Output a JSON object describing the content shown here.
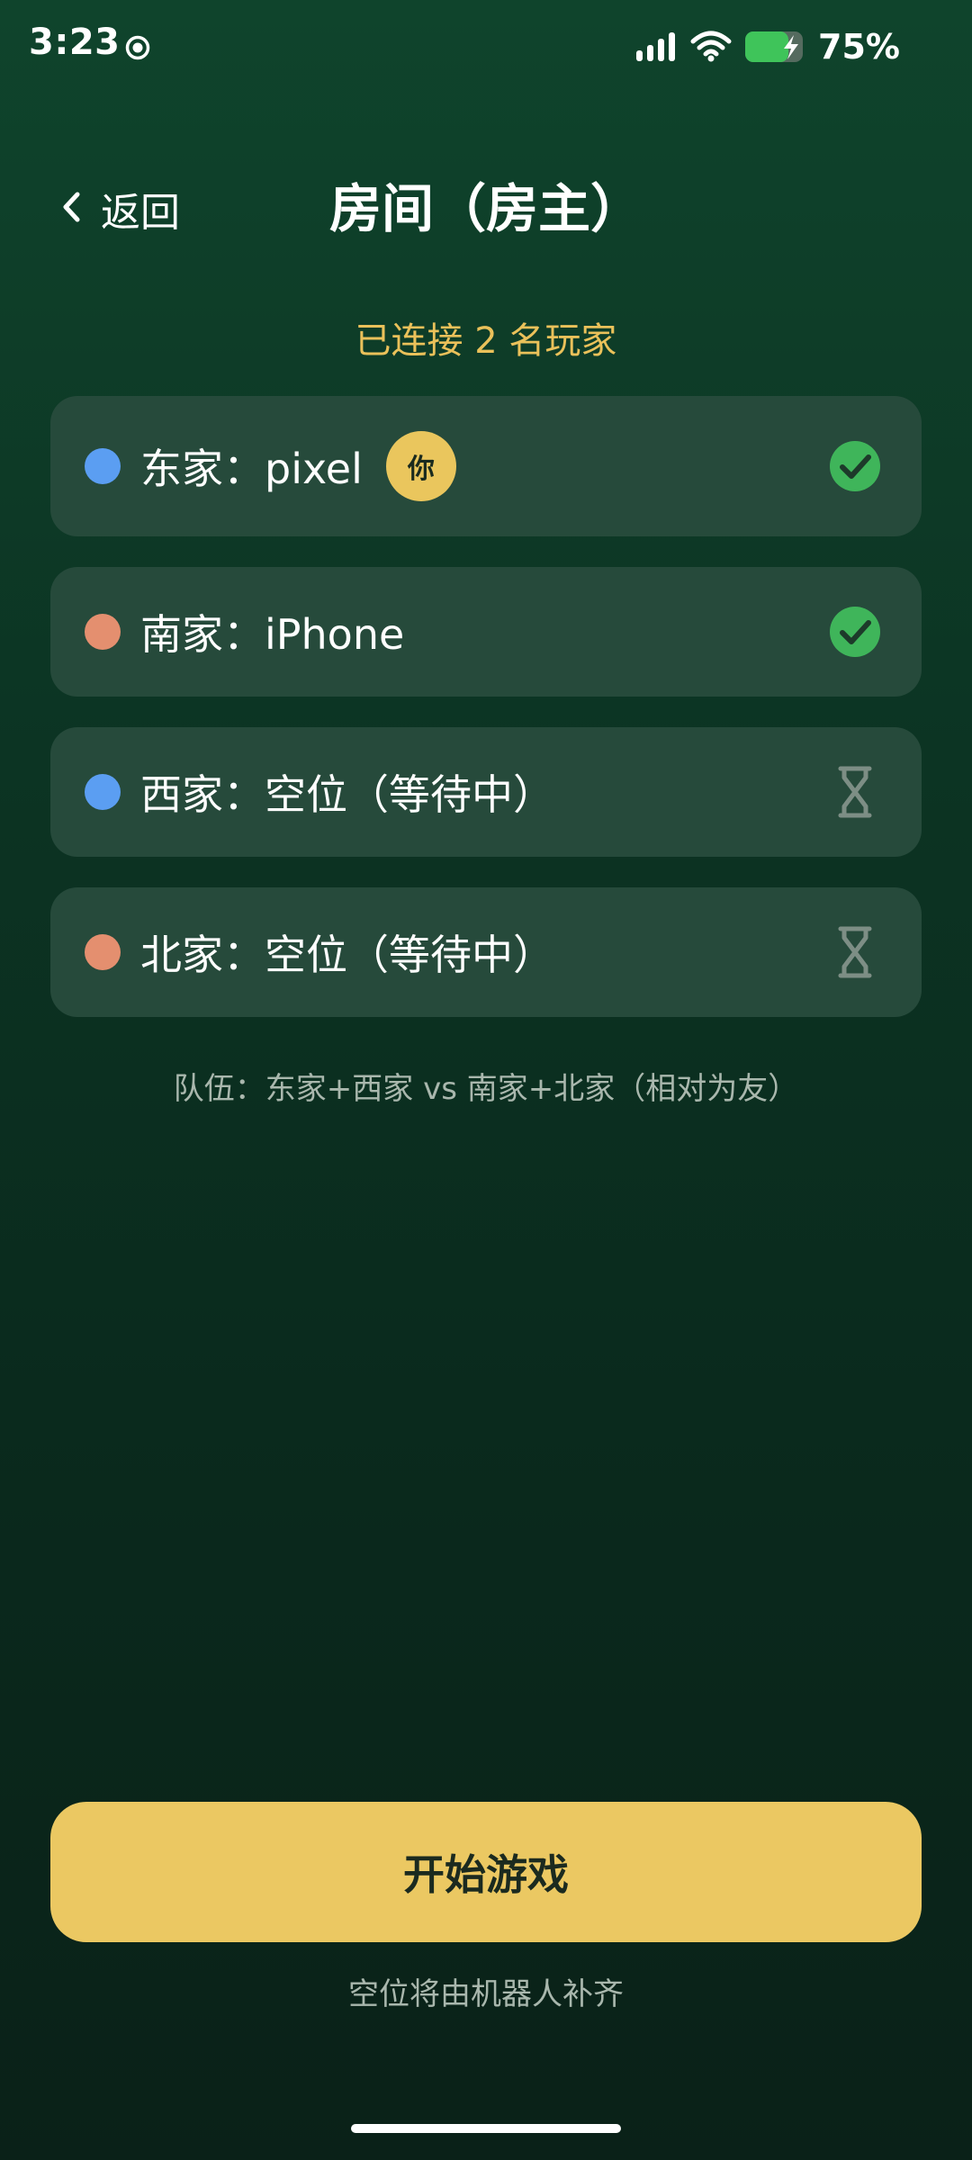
{
  "status_bar": {
    "time": "3:23",
    "battery_percent": "75%",
    "battery_level": 0.75,
    "icons": [
      "record-icon",
      "signal-icon",
      "wifi-icon",
      "battery-charging-icon"
    ]
  },
  "header": {
    "back_label": "返回",
    "title": "房间（房主）"
  },
  "connected_text": "已连接 2 名玩家",
  "players": [
    {
      "name": "东家：pixel",
      "badge": "你",
      "dot_color": "#5b9ef2",
      "status": "ready"
    },
    {
      "name": "南家：iPhone",
      "dot_color": "#e48f6f",
      "status": "ready"
    },
    {
      "name": "西家：空位（等待中）",
      "dot_color": "#5b9ef2",
      "status": "waiting"
    },
    {
      "name": "北家：空位（等待中）",
      "dot_color": "#e48f6f",
      "status": "waiting"
    }
  ],
  "team_info": "队伍：东家+西家 vs 南家+北家（相对为友）",
  "start_button": {
    "label": "开始游戏"
  },
  "hint": "空位将由机器人补齐",
  "colors": {
    "accent_yellow": "#ebc862",
    "ready_green": "#3fb55a",
    "waiting_gray": "#7d8e85",
    "card_bg": "#264a3b"
  }
}
